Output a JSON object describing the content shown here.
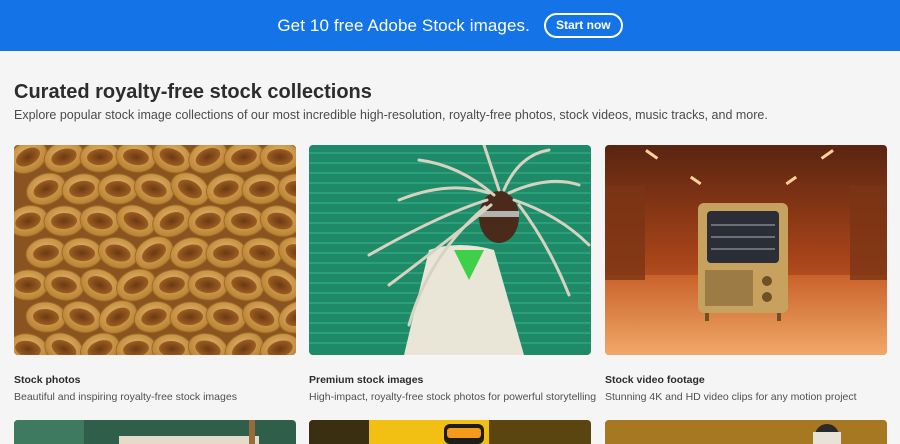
{
  "banner": {
    "text": "Get 10 free Adobe Stock images.",
    "button_label": "Start now",
    "background": "#1473e6"
  },
  "section": {
    "title": "Curated royalty-free stock collections",
    "subtitle": "Explore popular stock image collections of our most incredible high-resolution, royalty-free photos, stock videos, music tracks, and more."
  },
  "cards": [
    {
      "title": "Stock photos",
      "description": "Beautiful and inspiring royalty-free stock images",
      "image": "pasta-tubes-closeup"
    },
    {
      "title": "Premium stock images",
      "description": "High-impact, royalty-free stock photos for powerful storytelling",
      "image": "person-with-braids-green-wall"
    },
    {
      "title": "Stock video footage",
      "description": "Stunning 4K and HD video clips for any motion project",
      "image": "retro-tv-orange-room"
    }
  ],
  "next_row_cards": [
    {
      "image": "green-interior"
    },
    {
      "image": "yellow-object"
    },
    {
      "image": "person-headphones-gold"
    }
  ]
}
